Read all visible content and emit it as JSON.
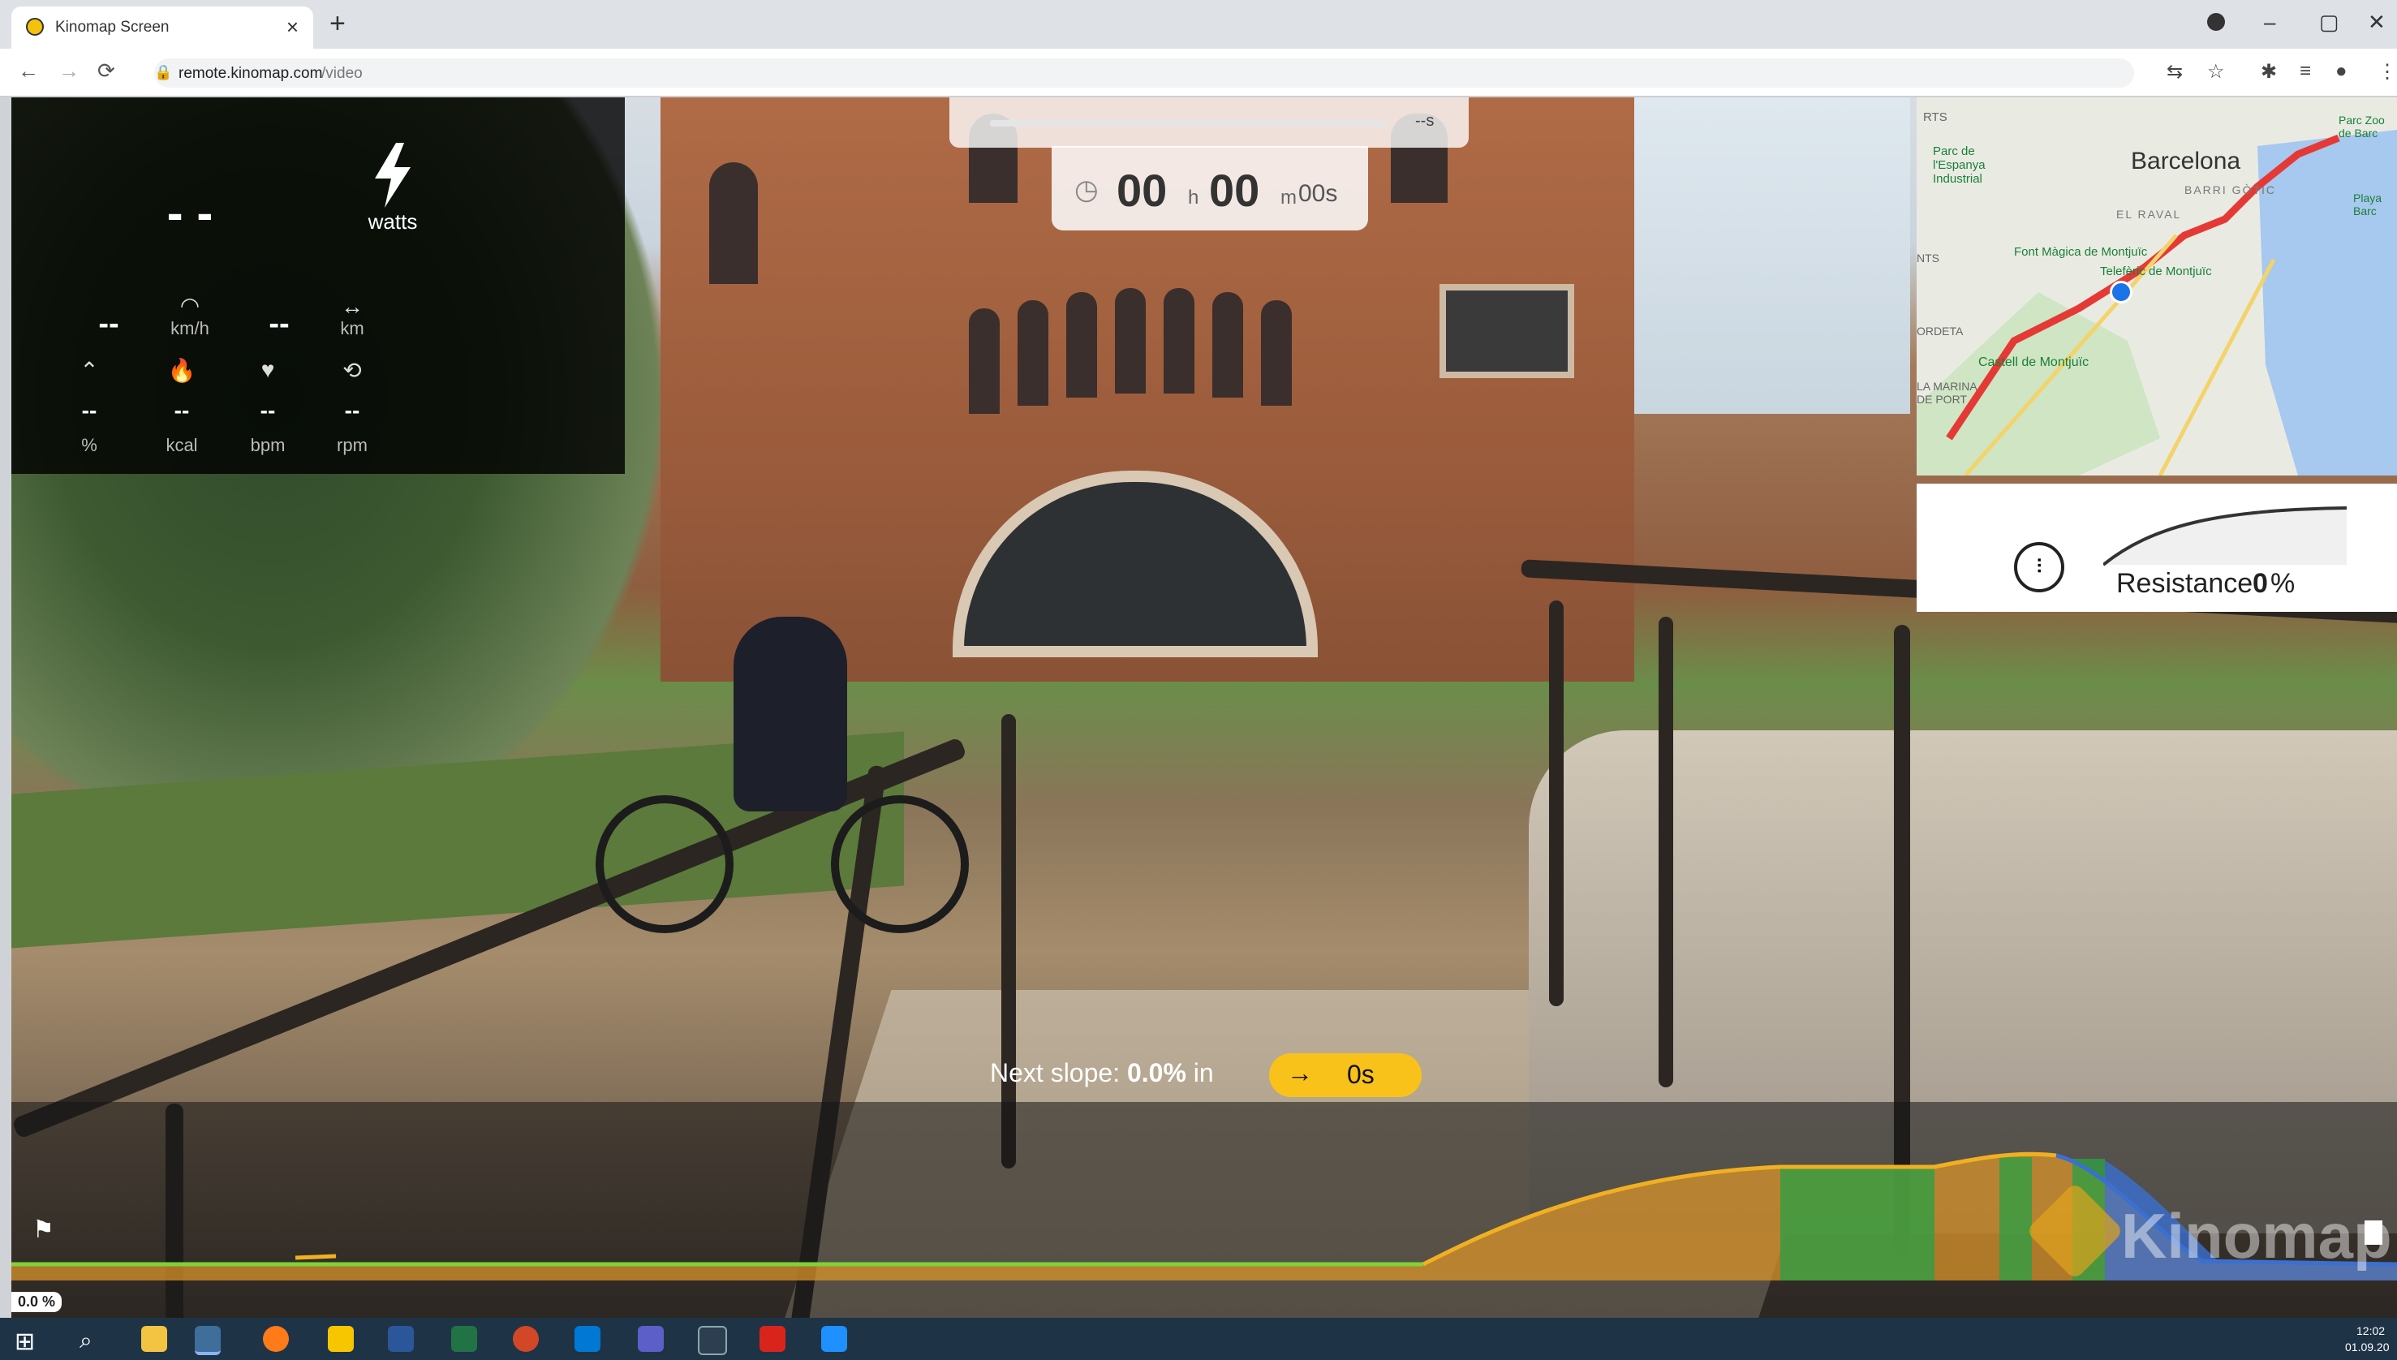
{
  "browser": {
    "tab_title": "Kinomap Screen",
    "tab_close": "×",
    "new_tab": "+",
    "url_host": "remote.kinomap.com",
    "url_path": "/video",
    "win_min": "–",
    "win_restore": "▢",
    "win_close": "✕"
  },
  "stats": {
    "power_value": "- -",
    "power_unit": "watts",
    "speed_value": "--",
    "speed_unit": "km/h",
    "distance_value": "--",
    "distance_unit": "km",
    "slope_value": "--",
    "slope_unit": "%",
    "calories_value": "--",
    "calories_unit": "kcal",
    "heart_value": "--",
    "heart_unit": "bpm",
    "cadence_value": "--",
    "cadence_unit": "rpm"
  },
  "progress": {
    "remaining": "--s"
  },
  "timer": {
    "hours": "00",
    "hours_unit": "h",
    "minutes": "00",
    "minutes_unit": "m",
    "seconds": "00s"
  },
  "map": {
    "labels": {
      "rts": "RTS",
      "parc": "Parc de\nl'Espanya\nIndustrial",
      "barcelona": "Barcelona",
      "barri": "BARRI GÒTIC",
      "raval": "EL RAVAL",
      "font": "Font Màgica de Montjuïc",
      "teleferic": "Telefèric de Montjuïc",
      "castell": "Castell de Montjuïc",
      "marina": "LA MARINA\nDE PORT",
      "ordeta": "ORDETA",
      "nts": "NTS",
      "parc_zoo": "Parc Zoo\nde Barc",
      "playa": "Playa\nBarc"
    }
  },
  "resistance": {
    "label": "Resistance",
    "value": "0",
    "suffix": "%"
  },
  "next_slope": {
    "prefix": "Next slope:",
    "value": "0.0%",
    "middle": "in",
    "arrow": "→",
    "time": "0s"
  },
  "profile": {
    "current_grade": "0.0 %",
    "brand": "Kinomap",
    "colors": {
      "flat": "#7ed23a",
      "mid": "#f0b021",
      "up": "#e8a317",
      "down": "#3b6fd0",
      "green_zone": "#2f9e44"
    }
  },
  "taskbar": {
    "time": "12:02",
    "date": "01.09.20"
  }
}
